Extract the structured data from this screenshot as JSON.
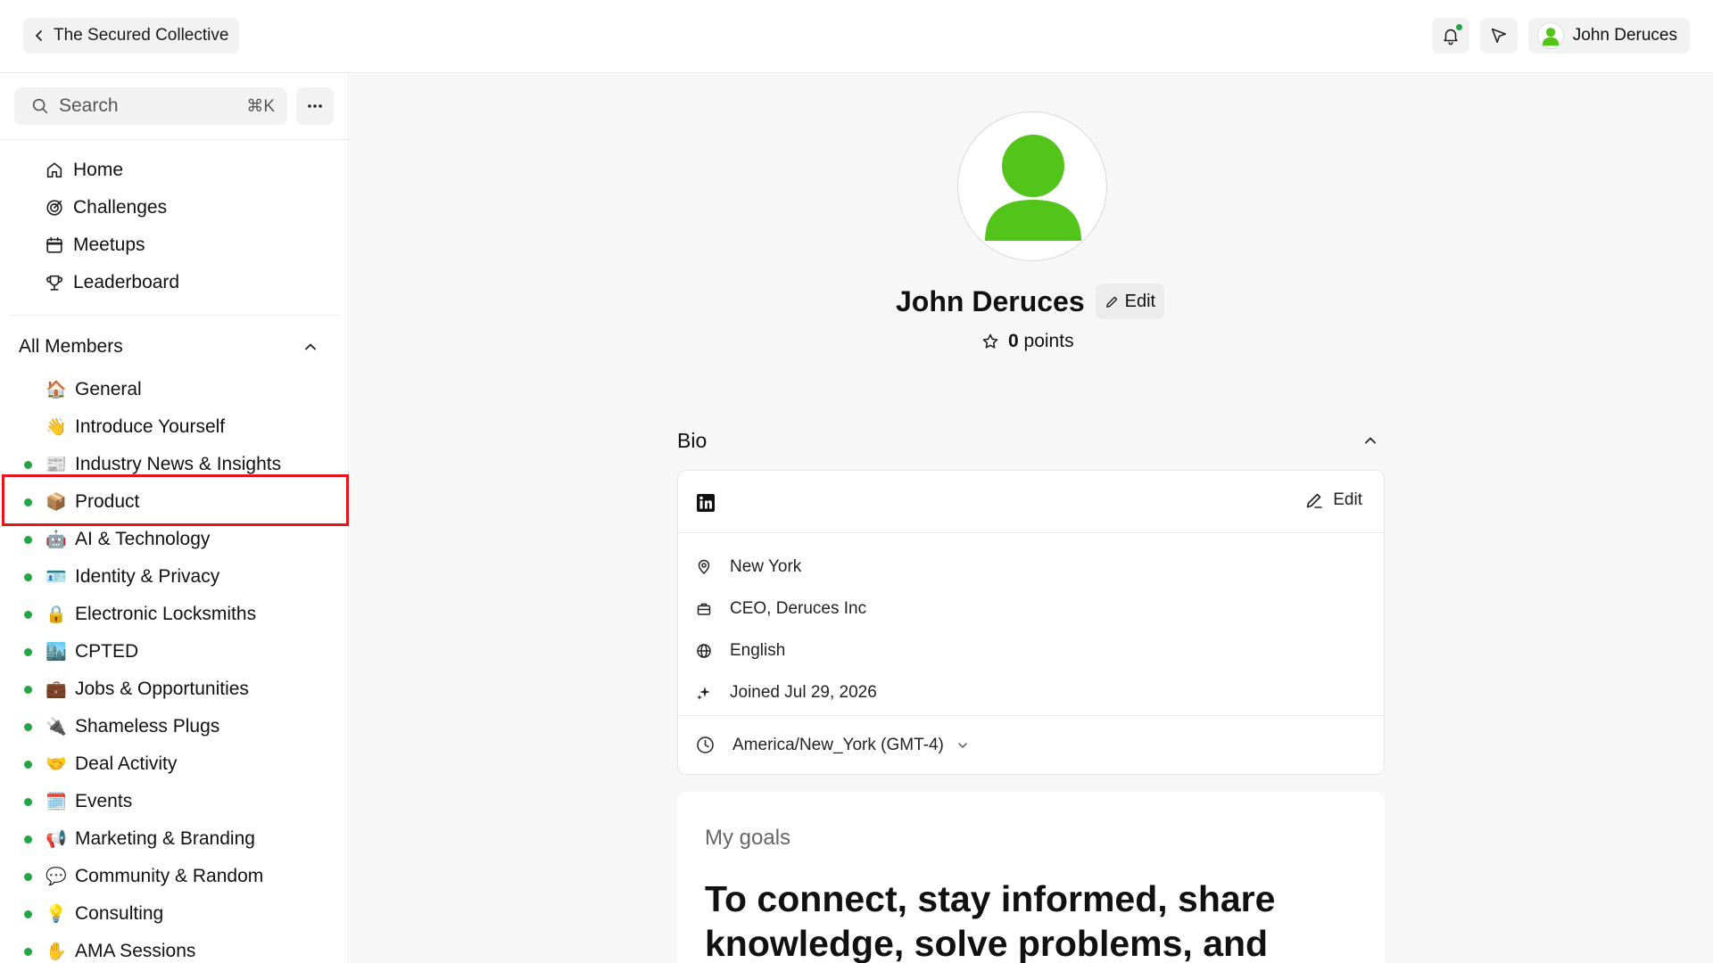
{
  "topbar": {
    "back_label": "The Secured Collective",
    "user_name": "John Deruces"
  },
  "sidebar": {
    "search_placeholder": "Search",
    "search_shortcut": "⌘K",
    "nav": [
      {
        "label": "Home",
        "icon": "home-icon"
      },
      {
        "label": "Challenges",
        "icon": "target-icon"
      },
      {
        "label": "Meetups",
        "icon": "calendar-icon"
      },
      {
        "label": "Leaderboard",
        "icon": "trophy-icon"
      }
    ],
    "members_header": "All Members",
    "channels": [
      {
        "emoji": "🏠",
        "label": "General",
        "unread": false
      },
      {
        "emoji": "👋",
        "label": "Introduce Yourself",
        "unread": false
      },
      {
        "emoji": "📰",
        "label": "Industry News & Insights",
        "unread": true
      },
      {
        "emoji": "📦",
        "label": "Product",
        "unread": true
      },
      {
        "emoji": "🤖",
        "label": "AI & Technology",
        "unread": true
      },
      {
        "emoji": "🪪",
        "label": "Identity & Privacy",
        "unread": true
      },
      {
        "emoji": "🔒",
        "label": "Electronic Locksmiths",
        "unread": true
      },
      {
        "emoji": "🏙️",
        "label": "CPTED",
        "unread": true
      },
      {
        "emoji": "💼",
        "label": "Jobs & Opportunities",
        "unread": true
      },
      {
        "emoji": "🔌",
        "label": "Shameless Plugs",
        "unread": true
      },
      {
        "emoji": "🤝",
        "label": "Deal Activity",
        "unread": true
      },
      {
        "emoji": "🗓️",
        "label": "Events",
        "unread": true
      },
      {
        "emoji": "📢",
        "label": "Marketing & Branding",
        "unread": true
      },
      {
        "emoji": "💬",
        "label": "Community & Random",
        "unread": true
      },
      {
        "emoji": "💡",
        "label": "Consulting",
        "unread": true
      },
      {
        "emoji": "✋",
        "label": "AMA Sessions",
        "unread": true
      }
    ]
  },
  "profile": {
    "name": "John Deruces",
    "edit_label": "Edit",
    "points_value": "0",
    "points_label": "points"
  },
  "bio": {
    "title": "Bio",
    "edit_label": "Edit",
    "location": "New York",
    "position": "CEO, Deruces Inc",
    "language": "English",
    "joined": "Joined Jul 29, 2026",
    "timezone": "America/New_York (GMT-4)"
  },
  "goals": {
    "label": "My goals",
    "text": "To connect, stay informed, share knowledge, solve problems, and"
  },
  "colors": {
    "accent_green": "#22a447",
    "avatar_green": "#52c41a",
    "highlight_red": "#e6141a"
  }
}
